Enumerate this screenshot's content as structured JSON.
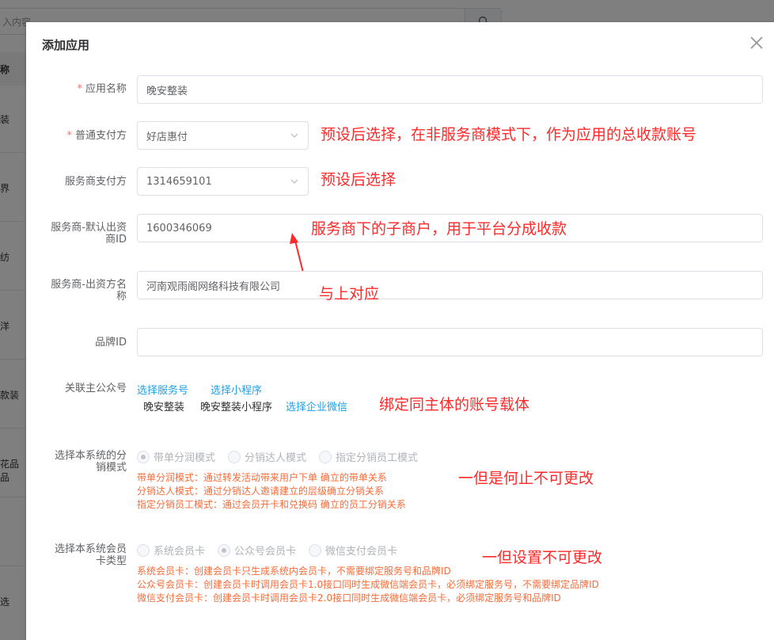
{
  "background": {
    "search_placeholder": "入内容",
    "side_header": "称",
    "side_items": [
      "装",
      "界",
      "纺",
      "洋",
      "款装",
      "花品品",
      "选"
    ]
  },
  "dialog": {
    "title": "添加应用",
    "fields": {
      "app_name": {
        "label": "应用名称",
        "required": true,
        "value": "晚安整装"
      },
      "normal_pay": {
        "label": "普通支付方",
        "required": true,
        "value": "好店惠付"
      },
      "provider_pay": {
        "label": "服务商支付方",
        "value": "1314659101"
      },
      "provider_default_id": {
        "label": "服务商-默认出资商ID",
        "value": "1600346069"
      },
      "provider_funder_name": {
        "label": "服务商-出资方名称",
        "value": "河南观雨阁网络科技有限公司"
      },
      "brand_id": {
        "label": "品牌ID",
        "value": ""
      },
      "linked_account": {
        "label": "关联主公众号",
        "select_service": "选择服务号",
        "select_mini": "选择小程序",
        "selected_service": "晚安整装",
        "selected_mini": "晚安整装小程序",
        "select_wecom": "选择企业微信"
      },
      "distribution_mode": {
        "label": "选择本系统的分销模式",
        "options": [
          "带单分润模式",
          "分销达人模式",
          "指定分销员工模式"
        ],
        "selected": 0,
        "notes": [
          "带单分润模式：通过转发活动带来用户下单 确立的带单关系",
          "分销达人模式：通过分销达人邀请建立的层级确立分销关系",
          "指定分销员工模式：通过会员开卡和兑换码 确立的员工分销关系"
        ]
      },
      "member_card": {
        "label": "选择本系统会员卡类型",
        "options": [
          "系统会员卡",
          "公众号会员卡",
          "微信支付会员卡"
        ],
        "selected": 1,
        "notes": [
          "系统会员卡：创建会员卡只生成系统内会员卡，不需要绑定服务号和品牌ID",
          "公众号会员卡：创建会员卡时调用会员卡1.0接口同时生成微信端会员卡，必须绑定服务号，不需要绑定品牌ID",
          "微信支付会员卡：创建会员卡时调用会员卡2.0接口同时生成微信端会员卡，必须绑定服务号和品牌ID"
        ]
      }
    }
  },
  "annotations": {
    "a1": "预设后选择，在非服务商模式下，作为应用的总收款账号",
    "a2": "预设后选择",
    "a3": "服务商下的子商户，用于平台分成收款",
    "a4": "与上对应",
    "a5": "绑定同主体的账号载体",
    "a6": "一但是何止不可更改",
    "a7": "一但设置不可更改"
  },
  "colors": {
    "annotation": "#ff2a2a",
    "link": "#1e9fe8",
    "note": "#f56c3a",
    "required": "#f56c6c"
  }
}
